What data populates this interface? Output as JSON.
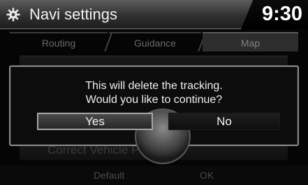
{
  "header": {
    "title": "Navi settings",
    "icon": "gear-icon",
    "time": "9:30"
  },
  "tabs": [
    {
      "label": "Routing",
      "active": false
    },
    {
      "label": "Guidance",
      "active": false
    },
    {
      "label": "Map",
      "active": true
    }
  ],
  "background_list": {
    "items": [
      "Correct Vehicle Position"
    ]
  },
  "bottom_bar": {
    "default_label": "Default",
    "ok_label": "OK"
  },
  "dialog": {
    "message_line1": "This will delete the tracking.",
    "message_line2": "Would you like to continue?",
    "yes_label": "Yes",
    "no_label": "No",
    "selected": "Yes"
  }
}
